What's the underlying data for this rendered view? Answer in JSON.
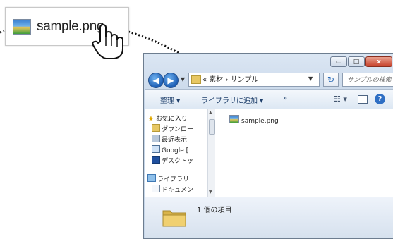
{
  "zoom": {
    "filename": "sample.png"
  },
  "window": {
    "caption_buttons": {
      "minimize": "▭",
      "maximize": "□",
      "close": "x"
    },
    "address": {
      "segments": "« 素材 › サンプル"
    },
    "search_placeholder": "サンプルの検索",
    "commands": {
      "organize": "整理 ▾",
      "add_library": "ライブラリに追加 ▾",
      "more": "»"
    },
    "nav_tree": [
      {
        "label": "お気に入り",
        "icon": "star-icon"
      },
      {
        "label": "ダウンロー",
        "icon": "download-folder-icon"
      },
      {
        "label": "最近表示",
        "icon": "recent-icon"
      },
      {
        "label": "Google [",
        "icon": "google-drive-icon"
      },
      {
        "label": "デスクトッ",
        "icon": "desktop-icon"
      },
      {
        "label": "ライブラリ",
        "icon": "library-icon"
      },
      {
        "label": "ドキュメン",
        "icon": "documents-icon"
      }
    ],
    "files": [
      {
        "name": "sample.png"
      }
    ],
    "status": {
      "count_text": "1 個の項目"
    }
  },
  "colors": {
    "accent": "#2f6fc4",
    "close": "#c7412b"
  }
}
